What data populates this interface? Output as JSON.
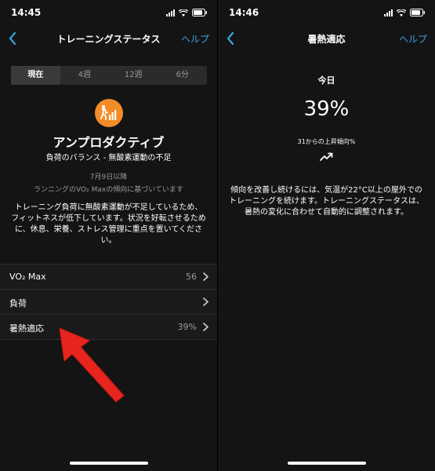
{
  "left": {
    "status_bar": {
      "time": "14:45"
    },
    "nav": {
      "title": "トレーニングステータス",
      "help": "ヘルプ"
    },
    "tabs": [
      "現在",
      "4週",
      "12週",
      "6分"
    ],
    "status": {
      "name": "アンプロダクティブ",
      "subtitle": "負荷のバランス - 無酸素運動の不足",
      "date": "7月9日以降",
      "basis": "ランニングのVO₂ Maxの傾向に基づいています",
      "description": "トレーニング負荷に無酸素運動が不足しているため、フィットネスが低下しています。状況を好転させるために、休息、栄養、ストレス管理に重点を置いてください。"
    },
    "list": [
      {
        "label": "VO₂ Max",
        "value": "56"
      },
      {
        "label": "負荷",
        "value": ""
      },
      {
        "label": "暑熱適応",
        "value": "39%"
      }
    ]
  },
  "right": {
    "status_bar": {
      "time": "14:46"
    },
    "nav": {
      "title": "暑熱適応",
      "help": "ヘルプ"
    },
    "label": "今日",
    "percent": "39%",
    "trend": "31からの上昇傾向%",
    "description": "傾向を改善し続けるには、気温が22°C以上の屋外でのトレーニングを続けます。トレーニングステータスは、暑熱の変化に合わせて自動的に調整されます。"
  },
  "colors": {
    "accent": "#3aa3e3",
    "status_orange": "#f28c28",
    "annotation_red": "#e8241e",
    "background": "#141414"
  }
}
